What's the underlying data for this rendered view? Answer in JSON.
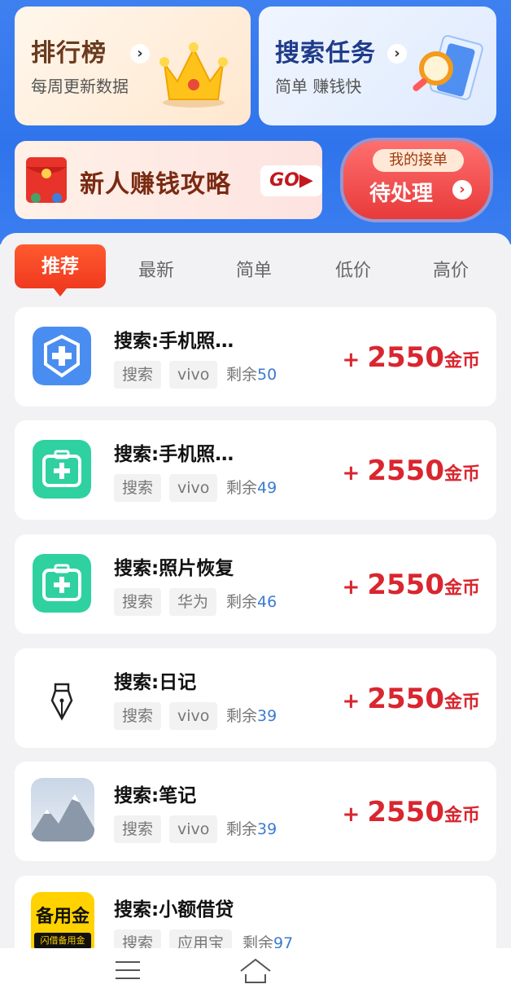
{
  "cards": {
    "rank": {
      "title": "排行榜",
      "subtitle": "每周更新数据"
    },
    "search": {
      "title": "搜索任务",
      "subtitle": "简单 赚钱快"
    },
    "guide": {
      "title": "新人赚钱攻略",
      "go": "GO▶"
    },
    "pending": {
      "top": "我的接单",
      "main": "待处理"
    }
  },
  "tabs": [
    "推荐",
    "最新",
    "简单",
    "低价",
    "高价"
  ],
  "tasks": [
    {
      "name": "搜索:手机照…",
      "tag1": "搜索",
      "tag2": "vivo",
      "remain_label": "剩余",
      "remain": "50",
      "plus": "+ ",
      "amount": "2550",
      "unit": "金币",
      "icon": "shield-plus-icon"
    },
    {
      "name": "搜索:手机照…",
      "tag1": "搜索",
      "tag2": "vivo",
      "remain_label": "剩余",
      "remain": "49",
      "plus": "+ ",
      "amount": "2550",
      "unit": "金币",
      "icon": "medkit-icon"
    },
    {
      "name": "搜索:照片恢复",
      "tag1": "搜索",
      "tag2": "华为",
      "remain_label": "剩余",
      "remain": "46",
      "plus": "+ ",
      "amount": "2550",
      "unit": "金币",
      "icon": "medkit-icon"
    },
    {
      "name": "搜索:日记",
      "tag1": "搜索",
      "tag2": "vivo",
      "remain_label": "剩余",
      "remain": "39",
      "plus": "+ ",
      "amount": "2550",
      "unit": "金币",
      "icon": "pen-nib-icon"
    },
    {
      "name": "搜索:笔记",
      "tag1": "搜索",
      "tag2": "vivo",
      "remain_label": "剩余",
      "remain": "39",
      "plus": "+ ",
      "amount": "2550",
      "unit": "金币",
      "icon": "mountain-icon"
    },
    {
      "name": "搜索:小额借贷",
      "tag1": "搜索",
      "tag2": "应用宝",
      "remain_label": "剩余",
      "remain": "97",
      "icon_text": "备用金",
      "icon_sub": "闪借备用金",
      "icon": "loan-app-icon"
    }
  ],
  "colors": {
    "accent": "#d9262f",
    "tab_active": "#f03a1f",
    "header_blue": "#2f74ec"
  }
}
